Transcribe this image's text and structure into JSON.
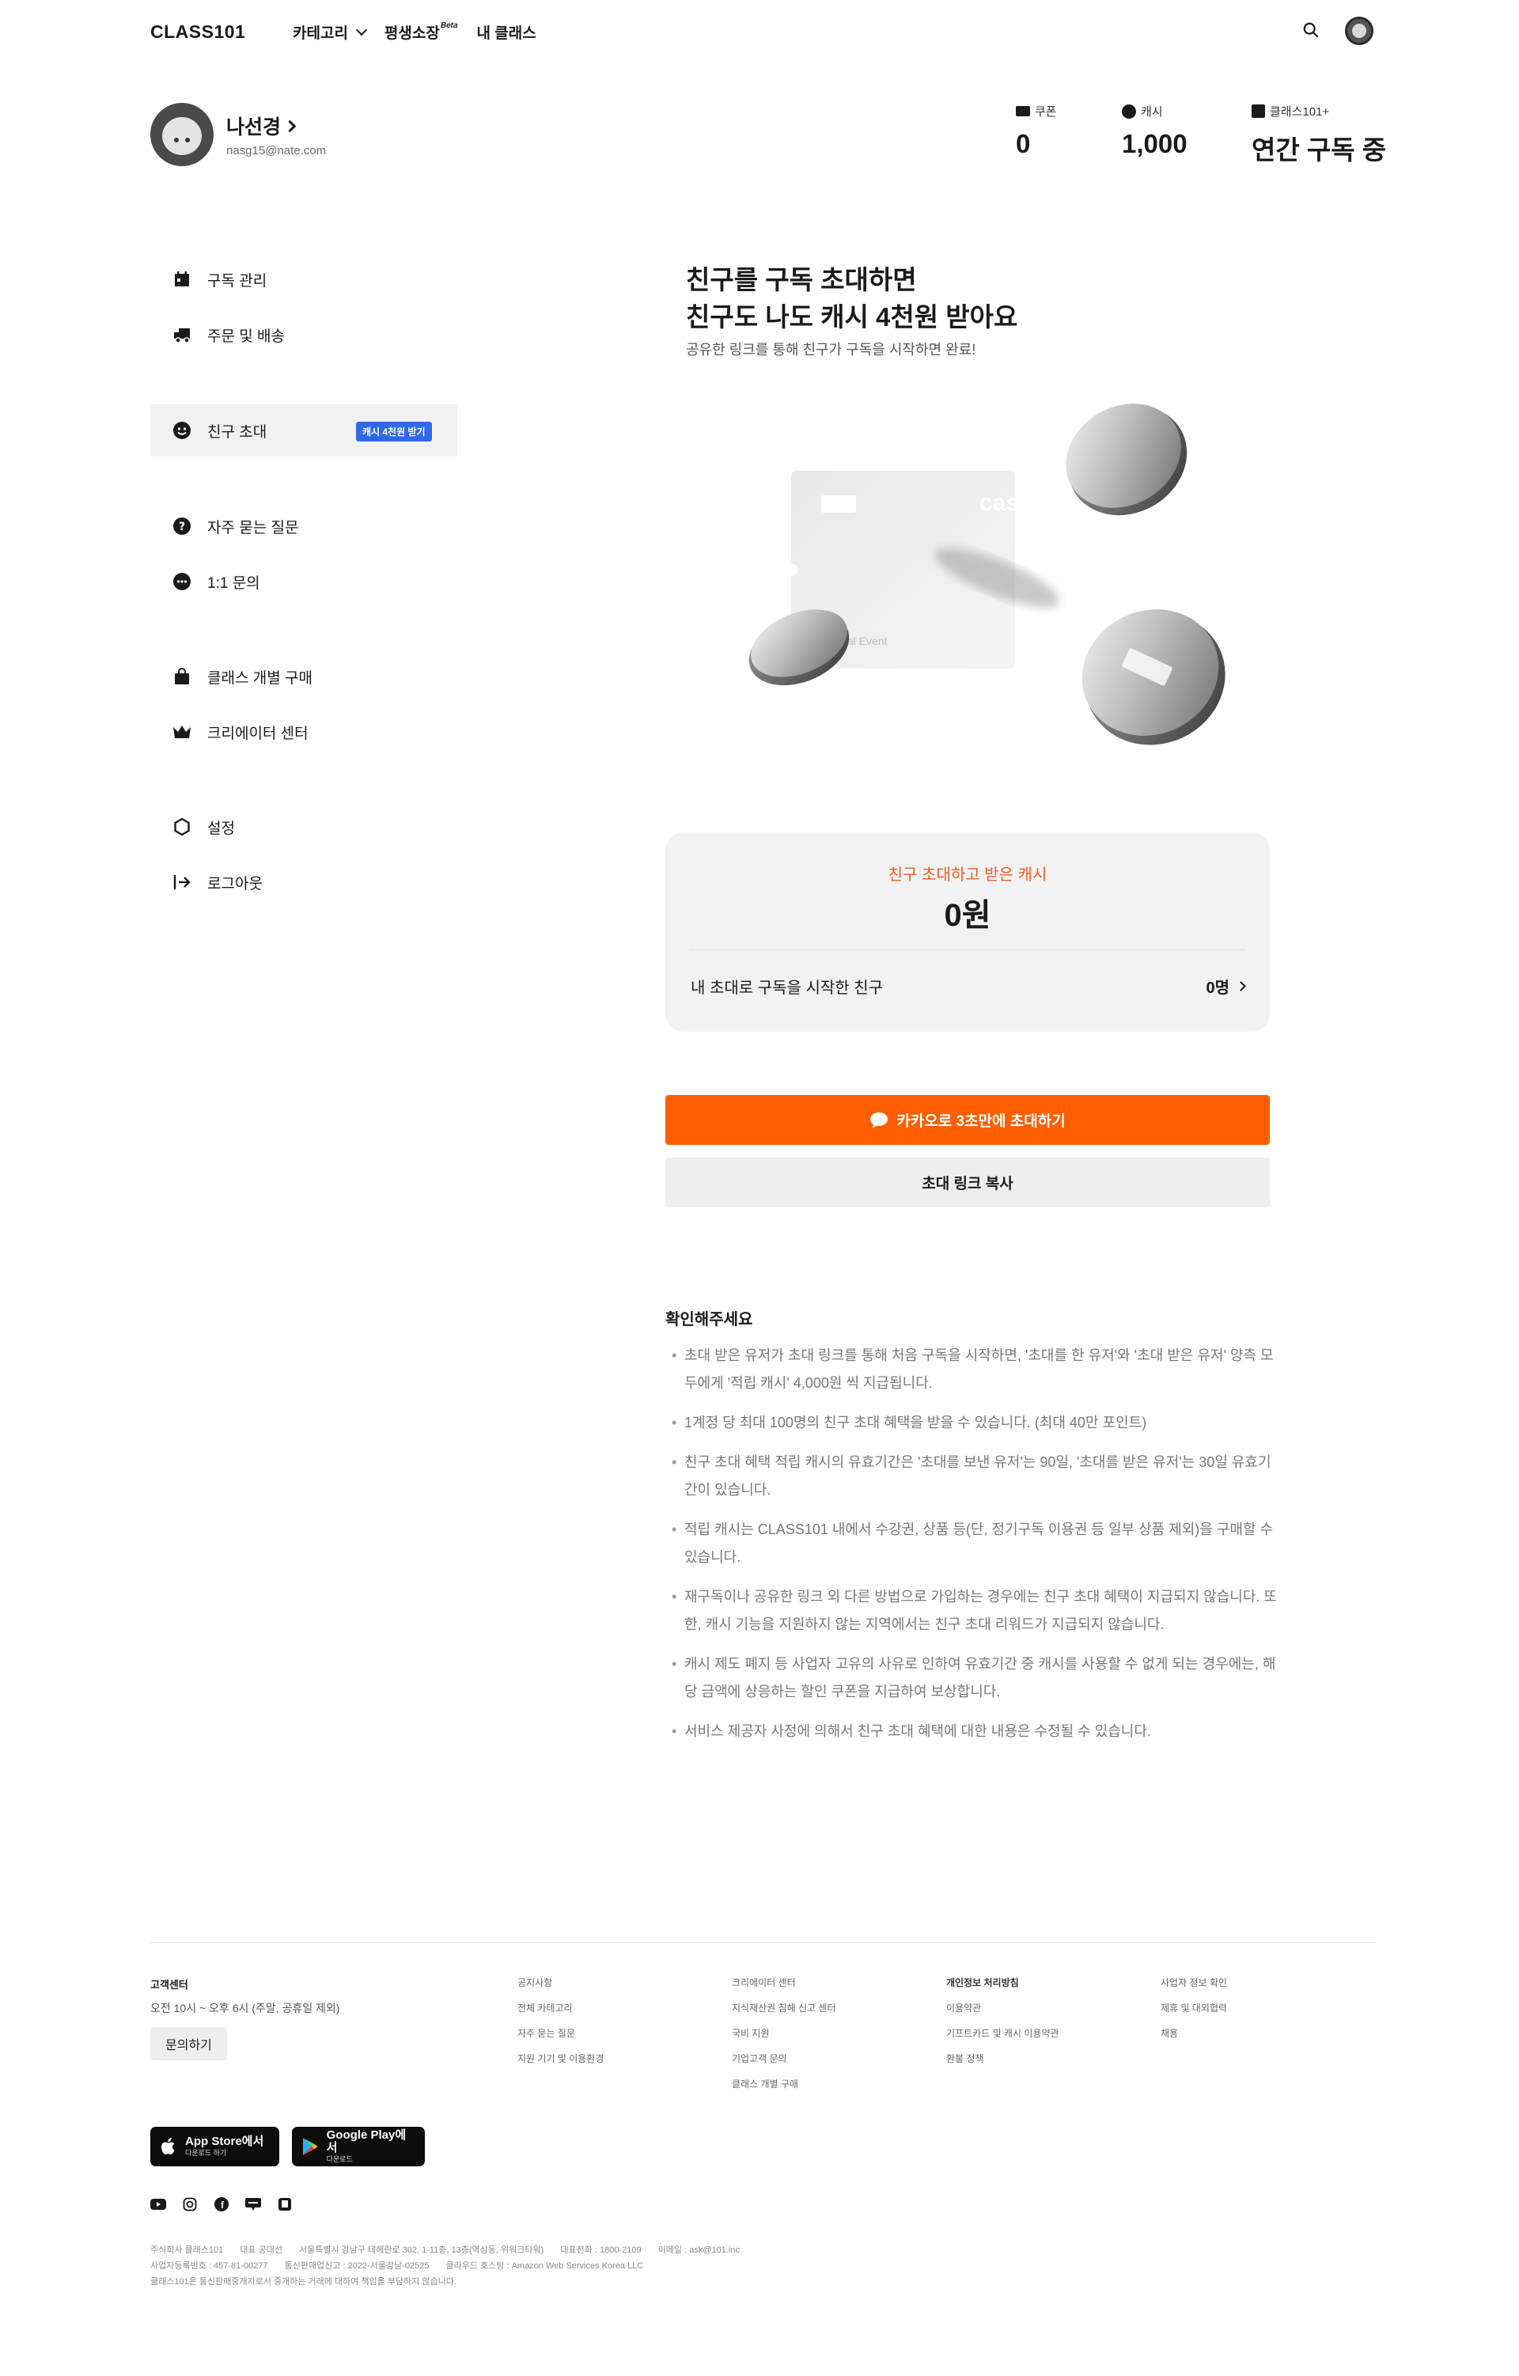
{
  "header": {
    "logo": "CLASS101",
    "nav": [
      {
        "label": "카테고리"
      },
      {
        "label": "평생소장",
        "sup": "Beta"
      },
      {
        "label": "내 클래스"
      }
    ]
  },
  "profile": {
    "name": "나선경",
    "email": "nasg15@nate.com",
    "stats": {
      "coupon_label": "쿠폰",
      "coupon_value": "0",
      "cash_label": "캐시",
      "cash_value": "1,000",
      "plus_label": "클래스101+",
      "plus_value": "연간 구독 중"
    }
  },
  "sidebar": {
    "items": [
      {
        "label": "구독 관리"
      },
      {
        "label": "주문 및 배송"
      },
      {
        "label": "친구 초대",
        "badge": "캐시 4천원 받기",
        "active": true
      },
      {
        "label": "자주 묻는 질문"
      },
      {
        "label": "1:1 문의"
      },
      {
        "label": "클래스 개별 구매"
      },
      {
        "label": "크리에이터 센터"
      },
      {
        "label": "설정"
      },
      {
        "label": "로그아웃"
      }
    ]
  },
  "main": {
    "title_line1": "친구를 구독 초대하면",
    "title_line2": "친구도 나도 캐시 4천원 받아요",
    "subtitle": "공유한 링크를 통해 친구가 구독을 시작하면 완료!",
    "card_brand": "cash",
    "card_footer": "Referral Event",
    "summary": {
      "caption": "친구 초대하고 받은 캐시",
      "amount": "0원",
      "row_label": "내 초대로 구독을 시작한 친구",
      "row_count": "0명"
    },
    "buttons": {
      "kakao": "카카오로 3초만에 초대하기",
      "copy": "초대 링크 복사"
    },
    "notice_title": "확인해주세요",
    "notices": [
      "초대 받은 유저가 초대 링크를 통해 처음 구독을 시작하면, '초대를 한 유저'와 '초대 받은 유저' 양측 모두에게 '적립 캐시' 4,000원 씩 지급됩니다.",
      "1계정 당 최대 100명의 친구 초대 혜택을 받을 수 있습니다. (최대 40만 포인트)",
      "친구 초대 혜택 적립 캐시의 유효기간은 '초대를 보낸 유저'는 90일, '초대를 받은 유저'는 30일 유효기간이 있습니다.",
      "적립 캐시는 CLASS101 내에서 수강권, 상품 등(단, 정기구독 이용권 등 일부 상품 제외)을 구매할 수 있습니다.",
      "재구독이나 공유한 링크 외 다른 방법으로 가입하는 경우에는 친구 초대 혜택이 지급되지 않습니다. 또한, 캐시 기능을 지원하지 않는 지역에서는 친구 초대 리워드가 지급되지 않습니다.",
      "캐시 제도 폐지 등 사업자 고유의 사유로 인하여 유효기간 중 캐시를 사용할 수 없게 되는 경우에는, 해당 금액에 상응하는 할인 쿠폰을 지급하여 보상합니다.",
      "서비스 제공자 사정에 의해서 친구 초대 혜택에 대한 내용은 수정될 수 있습니다."
    ]
  },
  "footer": {
    "cs_title": "고객센터",
    "cs_hours": "오전 10시 ~ 오후 6시 (주말, 공휴일 제외)",
    "cs_button": "문의하기",
    "col1": [
      "공지사항",
      "전체 카테고리",
      "자주 묻는 질문",
      "지원 기기 및 이용환경"
    ],
    "col2": [
      "크리에이터 센터",
      "지식재산권 침해 신고 센터",
      "국비 지원",
      "기업고객 문의",
      "클래스 개별 구매"
    ],
    "col3": [
      "개인정보 처리방침",
      "이용약관",
      "기프트카드 및 캐시 이용약관",
      "환불 정책"
    ],
    "col4": [
      "사업자 정보 확인",
      "제휴 및 대외협력",
      "채용"
    ],
    "appstore_main": "App Store에서",
    "appstore_sub": "다운로드 하기",
    "googleplay_main": "Google Play에서",
    "googleplay_sub": "다운로드",
    "legal_line1": [
      "주식회사 클래스101",
      "대표 공대선",
      "서울특별시 강남구 테헤란로 302, 1-11층, 13층(역삼동, 위워크타워)",
      "대표전화 : 1800-2109",
      "이메일 : ask@101.inc"
    ],
    "legal_line2": [
      "사업자등록번호 : 457-81-00277",
      "통신판매업신고 : 2022-서울강남-02525",
      "클라우드 호스팅 : Amazon Web Services Korea LLC"
    ],
    "legal_line3": "클래스101은 통신판매중개자로서 중개하는 거래에 대하여 책임을 부담하지 않습니다."
  }
}
